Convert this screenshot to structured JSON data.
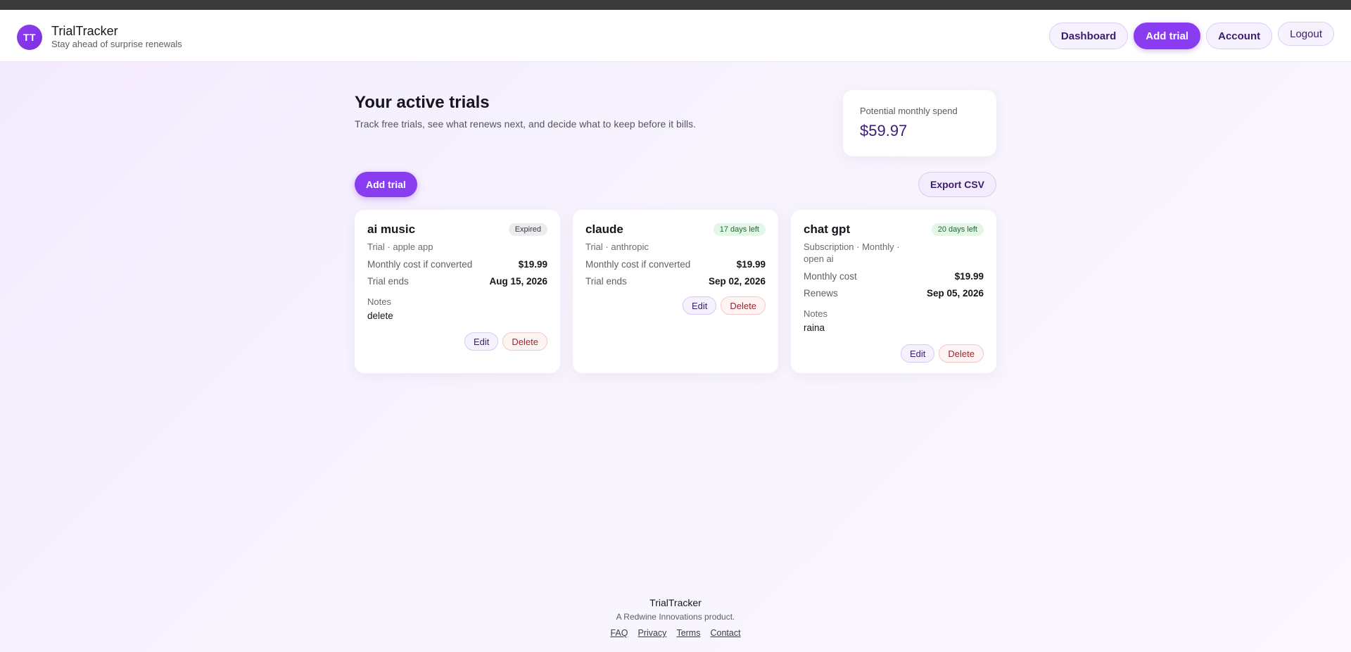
{
  "brand": {
    "initials": "TT",
    "name": "TrialTracker",
    "tagline": "Stay ahead of surprise renewals"
  },
  "nav": {
    "dashboard": "Dashboard",
    "add_trial": "Add trial",
    "account": "Account",
    "logout": "Logout"
  },
  "page": {
    "title": "Your active trials",
    "subtitle": "Track free trials, see what renews next, and decide what to keep before it bills."
  },
  "spend": {
    "label": "Potential monthly spend",
    "value": "$59.97"
  },
  "actions": {
    "add_trial": "Add trial",
    "export_csv": "Export CSV"
  },
  "cards": [
    {
      "title": "ai music",
      "badge": "Expired",
      "meta": "Trial · apple app",
      "cost_label": "Monthly cost if converted",
      "cost": "$19.99",
      "date_label": "Trial ends",
      "date": "Aug 15, 2026",
      "notes_label": "Notes",
      "notes": "delete",
      "edit": "Edit",
      "delete": "Delete"
    },
    {
      "title": "claude",
      "badge": "17 days left",
      "meta": "Trial · anthropic",
      "cost_label": "Monthly cost if converted",
      "cost": "$19.99",
      "date_label": "Trial ends",
      "date": "Sep 02, 2026",
      "edit": "Edit",
      "delete": "Delete"
    },
    {
      "title": "chat gpt",
      "badge": "20 days left",
      "meta": "Subscription · Monthly · open ai",
      "cost_label": "Monthly cost",
      "cost": "$19.99",
      "date_label": "Renews",
      "date": "Sep 05, 2026",
      "notes_label": "Notes",
      "notes": "raina",
      "edit": "Edit",
      "delete": "Delete"
    }
  ],
  "footer": {
    "name": "TrialTracker",
    "sub": "A Redwine Innovations product.",
    "links": [
      "FAQ",
      "Privacy",
      "Terms",
      "Contact"
    ]
  },
  "colors": {
    "accent": "#8a3cf0",
    "spend": "#3a1d78",
    "badge_active": "#1d6b35",
    "danger": "#a0262c"
  }
}
